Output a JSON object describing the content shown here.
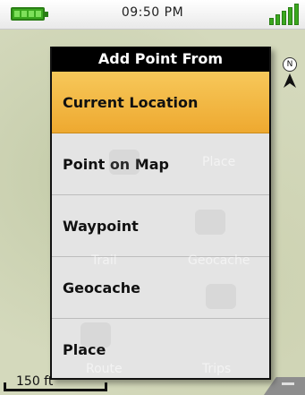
{
  "status_bar": {
    "time": "09:50 PM",
    "battery_icon": "battery-full-icon",
    "signal_icon": "signal-strength-icon",
    "accent_color": "#3aa81e"
  },
  "dialog": {
    "title": "Add Point From",
    "selected_color": "#f0b33c",
    "options": [
      {
        "label": "Current Location",
        "selected": true
      },
      {
        "label": "Point on Map",
        "selected": false
      },
      {
        "label": "Waypoint",
        "selected": false
      },
      {
        "label": "Geocache",
        "selected": false
      },
      {
        "label": "Place",
        "selected": false
      }
    ]
  },
  "background_menu": {
    "items": [
      "Place",
      "Trail",
      "Geocache",
      "Route",
      "Trips"
    ]
  },
  "map": {
    "compass_label": "N",
    "scale_label": "150 ft"
  }
}
